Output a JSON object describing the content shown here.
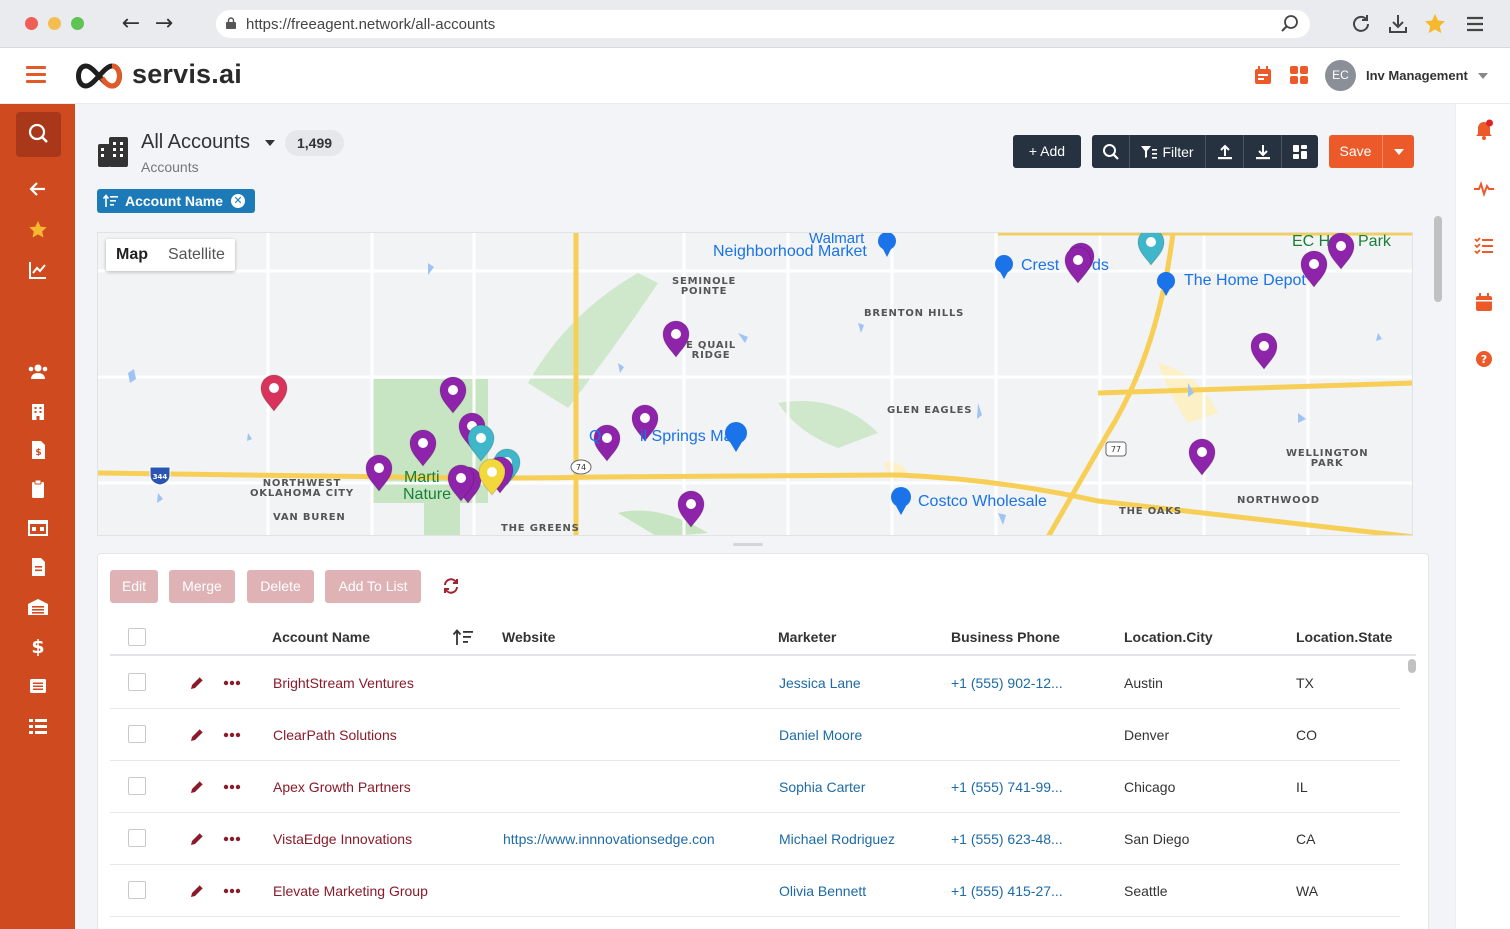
{
  "browser": {
    "url": "https://freeagent.network/all-accounts"
  },
  "app": {
    "logo_text": "servis.ai",
    "user_initials": "EC",
    "user_name": "Inv Management",
    "brand_color": "#cf4a1f",
    "accent_color": "#ec5a2a"
  },
  "page": {
    "title": "All Accounts",
    "count": "1,499",
    "subtitle": "Accounts",
    "sort_chip": "Account Name"
  },
  "toolbar": {
    "add_label": "+ Add",
    "filter_label": "Filter",
    "save_label": "Save"
  },
  "map": {
    "tab_map": "Map",
    "tab_satellite": "Satellite",
    "labels": {
      "seminole": "SEMINOLE\nPOINTE",
      "brenton": "BRENTON HILLS",
      "quail": "E QUAIL\nRIDGE",
      "glen": "GLEN EAGLES",
      "wellington": "WELLINGTON\nPARK",
      "northwest": "NORTHWEST\nOKLAHOMA CITY",
      "vanburen": "VAN BUREN",
      "oaks": "THE OAKS",
      "northwood": "NORTHWOOD",
      "greens": "THE GREENS"
    },
    "pois": {
      "walmart": "Walmart",
      "neighborhood": "Neighborhood Market",
      "crest": "Crest",
      "crest_tail": "ds",
      "homedepot": "The Home Depot",
      "ec_hafer": "EC H",
      "ec_park": "Park",
      "quail_mall": "Q",
      "quail_mall2": "il Springs Mall",
      "costco": "Costco Wholesale",
      "martin1": "Marti",
      "martin2": "Nature"
    },
    "highway_badges": {
      "i344": "344",
      "us74": "74",
      "us77": "77"
    }
  },
  "actions": {
    "edit": "Edit",
    "merge": "Merge",
    "delete": "Delete",
    "add_to_list": "Add To List"
  },
  "table": {
    "columns": {
      "name": "Account Name",
      "website": "Website",
      "marketer": "Marketer",
      "phone": "Business Phone",
      "city": "Location.City",
      "state": "Location.State"
    },
    "rows": [
      {
        "name": "BrightStream Ventures",
        "website": "",
        "marketer": "Jessica Lane",
        "phone": "+1 (555) 902-12...",
        "city": "Austin",
        "state": "TX"
      },
      {
        "name": "ClearPath Solutions",
        "website": "",
        "marketer": "Daniel Moore",
        "phone": "",
        "city": "Denver",
        "state": "CO"
      },
      {
        "name": "Apex Growth Partners",
        "website": "",
        "marketer": "Sophia Carter",
        "phone": "+1 (555) 741-99...",
        "city": "Chicago",
        "state": "IL"
      },
      {
        "name": "VistaEdge Innovations",
        "website": "https://www.innnovationsedge.con",
        "marketer": "Michael Rodriguez",
        "phone": "+1 (555) 623-48...",
        "city": "San Diego",
        "state": "CA"
      },
      {
        "name": "Elevate Marketing Group",
        "website": "",
        "marketer": "Olivia Bennett",
        "phone": "+1 (555) 415-27...",
        "city": "Seattle",
        "state": "WA"
      }
    ]
  }
}
